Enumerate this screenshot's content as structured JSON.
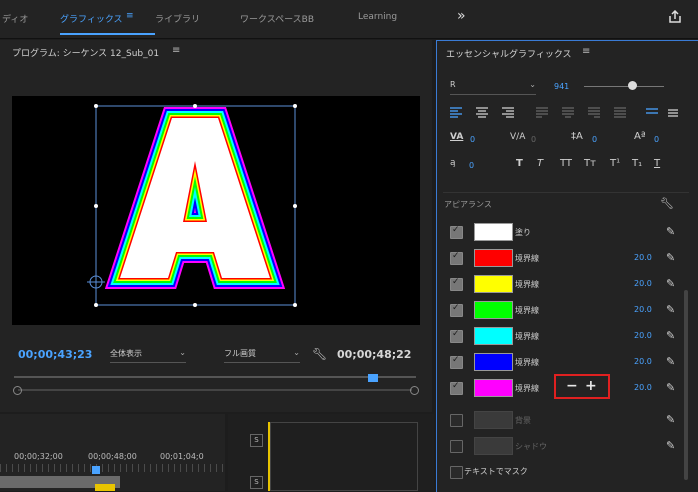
{
  "workspaces": [
    "ディオ",
    "グラフィックス",
    "ライブラリ",
    "ワークスペースBB",
    "Learning"
  ],
  "workspace_active_menu": "≡",
  "more_icon": "»",
  "share_icon": "⇪",
  "program": {
    "title": "プログラム: シーケンス 12_Sub_01",
    "menu": "≡",
    "letter": "A",
    "timecode_current": "00;00;43;23",
    "zoom": "全体表示",
    "quality": "フル画質",
    "timecode_duration": "00;00;48;22",
    "playhead_fraction": 0.9
  },
  "timeline": {
    "ruler": [
      "00;00;32;00",
      "00;00;48;00",
      "00;01;04;0"
    ],
    "track_labels": [
      "S",
      "S"
    ]
  },
  "egp": {
    "title": "エッセンシャルグラフィックス",
    "menu": "≡",
    "font": "R",
    "font_size": "941",
    "tracking": "0",
    "kerning": "0",
    "leading": "0",
    "baseline": "0",
    "tsume": "0",
    "text_styles": [
      "T",
      "T",
      "TT",
      "Tт",
      "T¹",
      "T₁",
      "T"
    ],
    "appearance_title": "アピアランス",
    "fill": {
      "label": "塗り",
      "color": "#ffffff"
    },
    "strokes": [
      {
        "label": "境界線",
        "color": "#ff0000",
        "value": "20.0"
      },
      {
        "label": "境界線",
        "color": "#ffff00",
        "value": "20.0"
      },
      {
        "label": "境界線",
        "color": "#00ff00",
        "value": "20.0"
      },
      {
        "label": "境界線",
        "color": "#00ffff",
        "value": "20.0"
      },
      {
        "label": "境界線",
        "color": "#0000ff",
        "value": "20.0"
      },
      {
        "label": "境界線",
        "color": "#ff00ff",
        "value": "20.0"
      }
    ],
    "minus": "−",
    "plus": "+",
    "background_label": "背景",
    "shadow_label": "シャドウ",
    "mask_label": "テキストでマスク"
  }
}
